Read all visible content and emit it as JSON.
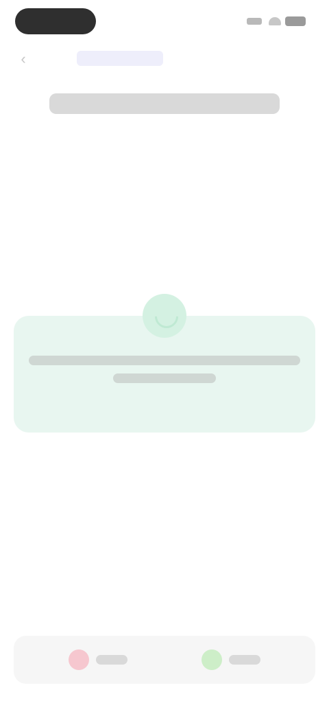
{
  "status_bar": {
    "pill_icon": "dynamic-island-icon",
    "signal_icon": "signal-icon",
    "wifi_icon": "wifi-icon",
    "battery_icon": "battery-icon"
  },
  "nav": {
    "back_icon": "back-icon",
    "link_label": ""
  },
  "page": {
    "title": ""
  },
  "card": {
    "icon": "success-icon",
    "line1": "",
    "line2": ""
  },
  "bottom_bar": {
    "left_icon": "reject-icon",
    "left_label": "",
    "right_icon": "accept-icon",
    "right_label": ""
  },
  "colors": {
    "card_bg": "#e8f6f0",
    "reject": "#f6c7cf",
    "accept": "#cdeec8",
    "link": "#c9c9ee"
  }
}
